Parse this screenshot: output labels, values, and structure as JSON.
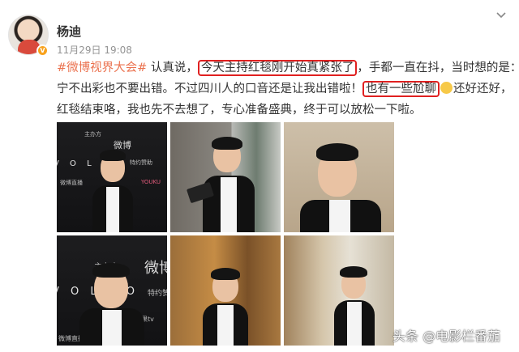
{
  "post": {
    "author": "杨迪",
    "timestamp": "11月29日 19:08",
    "line1": {
      "topic": "#微博视界大会#",
      "text_a": " 认真说，",
      "highlight1": "今天主持红毯刚开始真紧张了",
      "text_b": "，手都一直在抖，当时想的是："
    },
    "line2": {
      "text_a": "宁不出彩也不要出错。不过四川人的口音还是让我出错啦！",
      "highlight2": "也有一些尬聊",
      "text_b": "还好还好，"
    },
    "line3": "红毯结束咯，我也先不去想了，专心准备盛典，终于可以放松一下啦。"
  },
  "photos": {
    "backdrop_brand": {
      "host": "主办方",
      "weibo": "微博",
      "sponsor": "特约赞助",
      "volvo": "V O L V O",
      "sponsor_logo1": "微博直播",
      "sponsor_logo2": "YOUKU",
      "sponsor_logo3": "芒果tv"
    }
  },
  "watermark": "头条 @电影栏番茄",
  "colors": {
    "topic": "#eb7350",
    "highlight_border": "#e02020",
    "timestamp": "#939393"
  }
}
